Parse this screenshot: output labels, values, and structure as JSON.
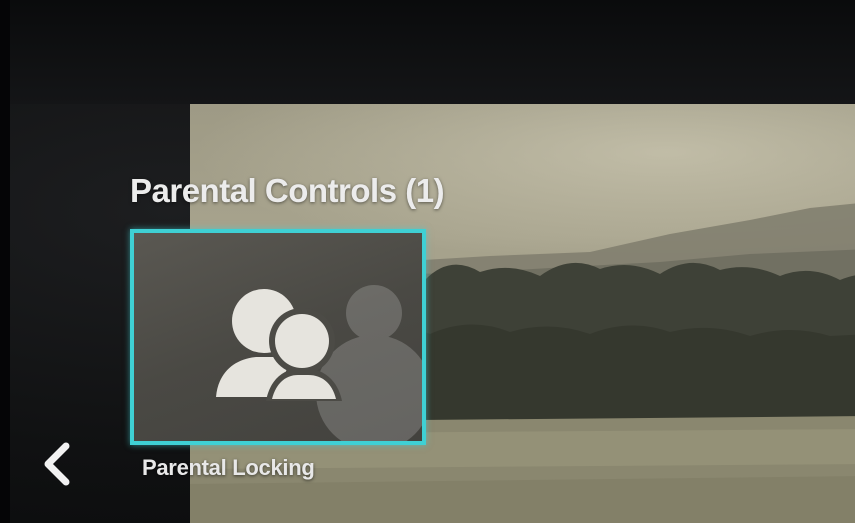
{
  "section": {
    "title": "Parental Controls (1)"
  },
  "tiles": [
    {
      "label": "Parental Locking",
      "icon": "users-icon",
      "selected": true
    }
  ],
  "navigation": {
    "back_icon": "chevron-left-icon"
  },
  "colors": {
    "focus_border": "#3fd0d4",
    "text": "#ececec",
    "tile_background": "#4a4944"
  }
}
